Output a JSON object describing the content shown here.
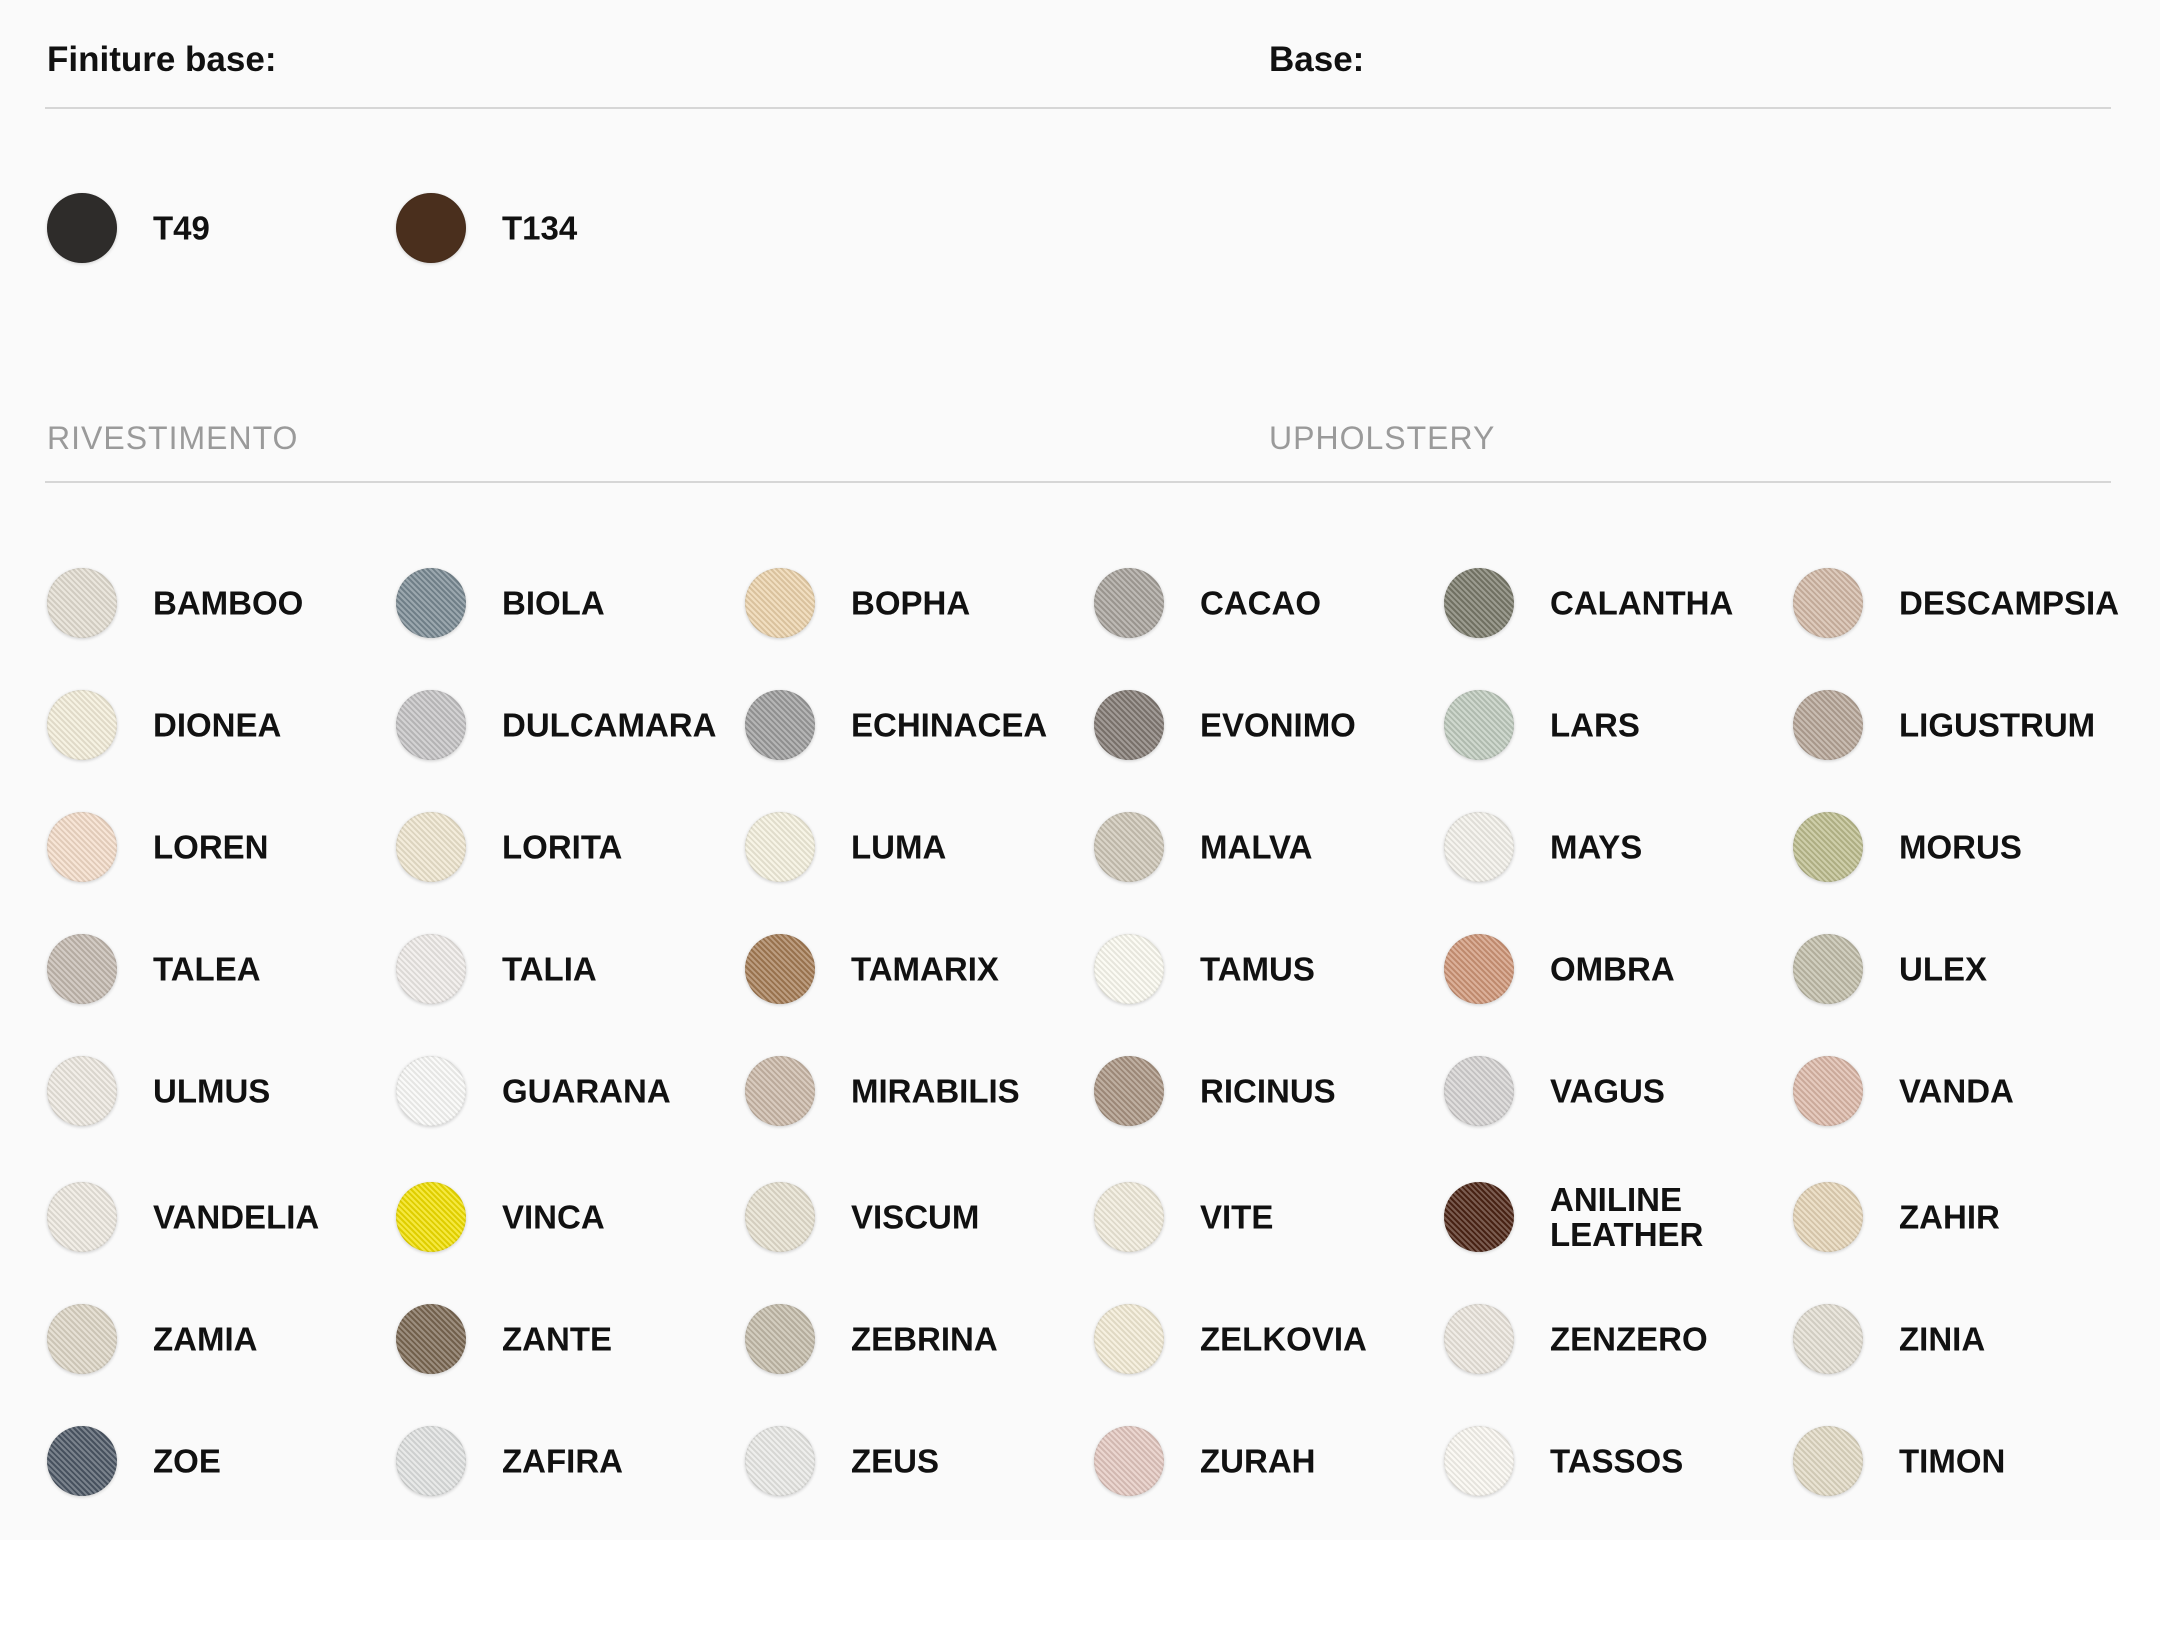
{
  "headers": {
    "finiture_label": "Finiture base:",
    "base_label": "Base:"
  },
  "base_finishes": [
    {
      "name": "T49",
      "color": "#2e2c2a"
    },
    {
      "name": "T134",
      "color": "#4a2f1d"
    }
  ],
  "sections": {
    "rivestimento_label": "RIVESTIMENTO",
    "upholstery_label": "UPHOLSTERY"
  },
  "upholstery": [
    {
      "name": "BAMBOO",
      "color": "#e3ddd1"
    },
    {
      "name": "BIOLA",
      "color": "#7a8a93"
    },
    {
      "name": "BOPHA",
      "color": "#ecd3ab"
    },
    {
      "name": "CACAO",
      "color": "#a7a29b"
    },
    {
      "name": "CALANTHA",
      "color": "#7a7a6a"
    },
    {
      "name": "DESCAMPSIA",
      "color": "#d2b9a6"
    },
    {
      "name": "DIONEA",
      "color": "#f3edd9"
    },
    {
      "name": "DULCAMARA",
      "color": "#c4c3c4"
    },
    {
      "name": "ECHINACEA",
      "color": "#9c9c9c"
    },
    {
      "name": "EVONIMO",
      "color": "#827973"
    },
    {
      "name": "LARS",
      "color": "#bfcbbe"
    },
    {
      "name": "LIGUSTRUM",
      "color": "#b6a597"
    },
    {
      "name": "LOREN",
      "color": "#f4dcc9"
    },
    {
      "name": "LORITA",
      "color": "#efe6cf"
    },
    {
      "name": "LUMA",
      "color": "#f4f0dd"
    },
    {
      "name": "MALVA",
      "color": "#cdc6b6"
    },
    {
      "name": "MAYS",
      "color": "#f3f1ea"
    },
    {
      "name": "MORUS",
      "color": "#bdbd8e"
    },
    {
      "name": "TALEA",
      "color": "#c4bab0"
    },
    {
      "name": "TALIA",
      "color": "#efebe8"
    },
    {
      "name": "TAMARIX",
      "color": "#a57c55"
    },
    {
      "name": "TAMUS",
      "color": "#fbfaf0"
    },
    {
      "name": "OMBRA",
      "color": "#cf9677"
    },
    {
      "name": "ULEX",
      "color": "#c1bda9"
    },
    {
      "name": "ULMUS",
      "color": "#ede8e0"
    },
    {
      "name": "GUARANA",
      "color": "#f9f9f7"
    },
    {
      "name": "MIRABILIS",
      "color": "#cbb9a8"
    },
    {
      "name": "RICINUS",
      "color": "#a99482"
    },
    {
      "name": "VAGUS",
      "color": "#d5d3d2"
    },
    {
      "name": "VANDA",
      "color": "#dcb8a8"
    },
    {
      "name": "VANDELIA",
      "color": "#ede8df"
    },
    {
      "name": "VINCA",
      "color": "#f2e000"
    },
    {
      "name": "VISCUM",
      "color": "#e6e0cf"
    },
    {
      "name": "VITE",
      "color": "#f1ebdb"
    },
    {
      "name": "ANILINE\nLEATHER",
      "color": "#4d2516"
    },
    {
      "name": "ZAHIR",
      "color": "#e6d5b7"
    },
    {
      "name": "ZAMIA",
      "color": "#ddd6c6"
    },
    {
      "name": "ZANTE",
      "color": "#7b6853"
    },
    {
      "name": "ZEBRINA",
      "color": "#c4bcaa"
    },
    {
      "name": "ZELKOVIA",
      "color": "#f3ebd5"
    },
    {
      "name": "ZENZERO",
      "color": "#ebe6dd"
    },
    {
      "name": "ZINIA",
      "color": "#e3ded2"
    },
    {
      "name": "ZOE",
      "color": "#4d5866"
    },
    {
      "name": "ZAFIRA",
      "color": "#e0e2e1"
    },
    {
      "name": "ZEUS",
      "color": "#e9e9e6"
    },
    {
      "name": "ZURAH",
      "color": "#e4c8c0"
    },
    {
      "name": "TASSOS",
      "color": "#faf7f1"
    },
    {
      "name": "TIMON",
      "color": "#e2dac4"
    }
  ]
}
